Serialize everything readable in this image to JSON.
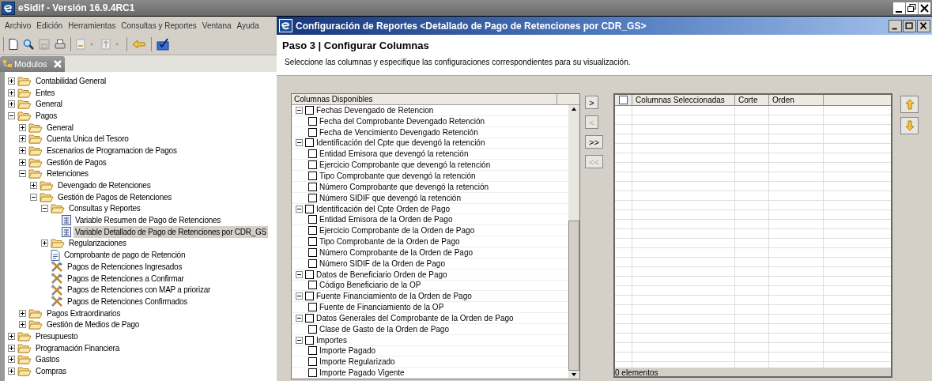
{
  "app_window": {
    "title": "eSidif - Versión 16.9.4RC1"
  },
  "menu": [
    "Archivo",
    "Edición",
    "Herramientas",
    "Consultas y Reportes",
    "Ventana",
    "Ayuda"
  ],
  "modules_tab": {
    "label": "Modulos"
  },
  "tree": [
    {
      "label": "Contabilidad General",
      "kind": "folder",
      "expanded": false,
      "selected": false
    },
    {
      "label": "Entes",
      "kind": "folder",
      "expanded": false,
      "selected": false
    },
    {
      "label": "General",
      "kind": "folder",
      "expanded": false,
      "selected": false
    },
    {
      "label": "Pagos",
      "kind": "folder",
      "expanded": true,
      "selected": false,
      "children": [
        {
          "label": "General",
          "kind": "folder",
          "expanded": false,
          "selected": false
        },
        {
          "label": "Cuenta Unica del Tesoro",
          "kind": "folder",
          "expanded": false,
          "selected": false
        },
        {
          "label": "Escenarios de Programacion de Pagos",
          "kind": "folder",
          "expanded": false,
          "selected": false
        },
        {
          "label": "Gestión de Pagos",
          "kind": "folder",
          "expanded": false,
          "selected": false
        },
        {
          "label": "Retenciones",
          "kind": "folder",
          "expanded": true,
          "selected": false,
          "children": [
            {
              "label": "Devengado de Retenciones",
              "kind": "folder",
              "expanded": false,
              "selected": false
            },
            {
              "label": "Gestión de Pagos de Retenciones",
              "kind": "folder",
              "expanded": true,
              "selected": false,
              "children": [
                {
                  "label": "Consultas y Reportes",
                  "kind": "folder",
                  "expanded": true,
                  "selected": false,
                  "children": [
                    {
                      "label": "Variable Resumen de Pago de Retenciones",
                      "kind": "report",
                      "selected": false
                    },
                    {
                      "label": "Variable Detallado de Pago de Retenciones por CDR_GS",
                      "kind": "report",
                      "selected": true
                    }
                  ]
                },
                {
                  "label": "Regularizaciones",
                  "kind": "folder",
                  "expanded": false,
                  "selected": false
                },
                {
                  "label": "Comprobante de pago de Retención",
                  "kind": "document",
                  "selected": false
                },
                {
                  "label": "Pagos de Retenciones Ingresados",
                  "kind": "tool",
                  "selected": false
                },
                {
                  "label": "Pagos de Retenciones a Confirmar",
                  "kind": "tool",
                  "selected": false
                },
                {
                  "label": "Pagos de Retenciones con MAP a priorizar",
                  "kind": "tool",
                  "selected": false
                },
                {
                  "label": "Pagos de Retenciones Confirmados",
                  "kind": "tool",
                  "selected": false
                }
              ]
            }
          ]
        },
        {
          "label": "Pagos Extraordinarios",
          "kind": "folder",
          "expanded": false,
          "selected": false
        },
        {
          "label": "Gestión de Medios de Pago",
          "kind": "folder",
          "expanded": false,
          "selected": false
        }
      ]
    },
    {
      "label": "Presupuesto",
      "kind": "folder",
      "expanded": false,
      "selected": false
    },
    {
      "label": "Programación Financiera",
      "kind": "folder",
      "expanded": false,
      "selected": false
    },
    {
      "label": "Gastos",
      "kind": "folder",
      "expanded": false,
      "selected": false
    },
    {
      "label": "Compras",
      "kind": "folder",
      "expanded": false,
      "selected": false
    }
  ],
  "dialog": {
    "title": "Configuración de Reportes <Detallado de Pago de Retenciones por CDR_GS>",
    "step_title": "Paso 3 | Configurar Columnas",
    "step_description": "Seleccione las columnas y especifique las configuraciones correspondientes para su visualización.",
    "available_header": "Columnas Disponibles",
    "available": [
      {
        "label": "Fechas Devengado de Retencion",
        "checked": false,
        "expanded": true,
        "children": [
          {
            "label": "Fecha del Comprobante Devengado Retención",
            "checked": false
          },
          {
            "label": "Fecha de Vencimiento Devengado Retención",
            "checked": false
          }
        ]
      },
      {
        "label": "Identificación del Cpte que devengó la retención",
        "checked": false,
        "expanded": true,
        "children": [
          {
            "label": "Entidad Emisora que devengó la retención",
            "checked": false
          },
          {
            "label": "Ejercicio Comprobante que devengó la retención",
            "checked": false
          },
          {
            "label": "Tipo Comprobante que devengó la retención",
            "checked": false
          },
          {
            "label": "Número Comprobante que devengó la retención",
            "checked": false
          },
          {
            "label": "Número SIDIF que devengó la retención",
            "checked": false
          }
        ]
      },
      {
        "label": "Identificación del Cpte Orden de Pago",
        "checked": false,
        "expanded": true,
        "children": [
          {
            "label": "Entidad Emisora de la Orden de Pago",
            "checked": false
          },
          {
            "label": "Ejercicio Comprobante de la Orden de Pago",
            "checked": false
          },
          {
            "label": "Tipo Comprobante de la Orden de Pago",
            "checked": false
          },
          {
            "label": "Número Comprobante de la Orden de Pago",
            "checked": false
          },
          {
            "label": "Número SIDIF de la Orden de Pago",
            "checked": false
          }
        ]
      },
      {
        "label": "Datos de Beneficiario Orden de Pago",
        "checked": false,
        "expanded": true,
        "children": [
          {
            "label": "Código Beneficiario de la OP",
            "checked": false
          }
        ]
      },
      {
        "label": "Fuente Financiamiento de la Orden de Pago",
        "checked": false,
        "expanded": true,
        "children": [
          {
            "label": "Fuente de Financiamiento de la OP",
            "checked": false
          }
        ]
      },
      {
        "label": "Datos Generales del Comprobante de la Orden de Pago",
        "checked": false,
        "expanded": true,
        "children": [
          {
            "label": "Clase de Gasto de la Orden de Pago",
            "checked": false
          }
        ]
      },
      {
        "label": "Importes",
        "checked": false,
        "expanded": true,
        "children": [
          {
            "label": "Importe Pagado",
            "checked": false
          },
          {
            "label": "Importe Regularizado",
            "checked": false
          },
          {
            "label": "Importe Pagado Vigente",
            "checked": false
          }
        ]
      }
    ],
    "transfer_buttons": [
      {
        "label": ">",
        "disabled": false
      },
      {
        "label": "<",
        "disabled": true
      },
      {
        "label": ">>",
        "disabled": false
      },
      {
        "label": "<<",
        "disabled": true
      }
    ],
    "selected_table": {
      "select_all_checked": false,
      "columns": [
        "Columnas Seleccionadas",
        "Corte",
        "Orden"
      ],
      "status": "0 elementos"
    }
  }
}
